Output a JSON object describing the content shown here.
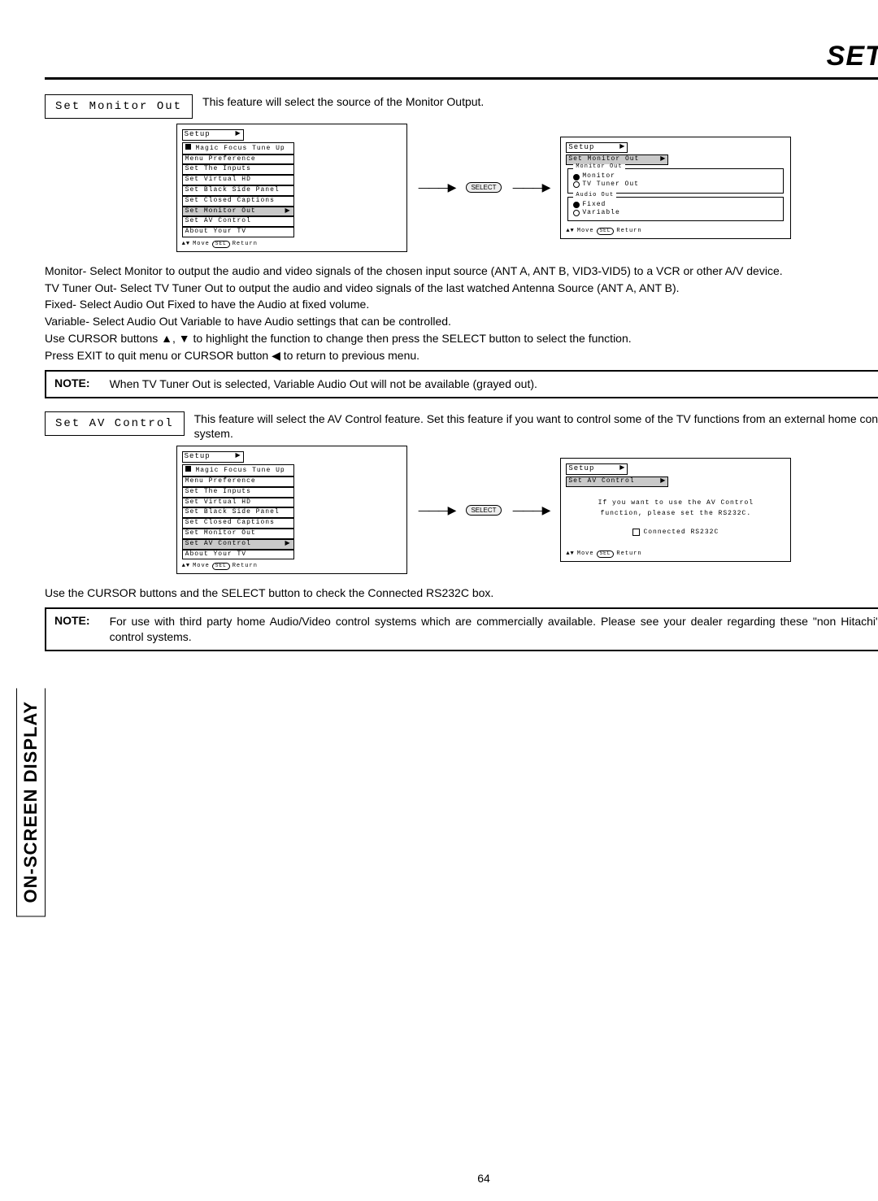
{
  "title": "Setup",
  "side_tab": "On-Screen Display",
  "page_number": "64",
  "sec1": {
    "label": "Set Monitor Out",
    "desc": "This feature will select the source of the Monitor Output.",
    "menu_title": "Setup",
    "items": [
      "Magic Focus Tune Up",
      "Menu Preference",
      "Set The Inputs",
      "Set Virtual HD",
      "Set Black Side Panel",
      "Set Closed Captions",
      "Set Monitor Out",
      "Set AV Control",
      "About Your TV"
    ],
    "highlight": "Set Monitor Out",
    "foot_move": "Move",
    "foot_sel": "SEL",
    "foot_return": "Return",
    "select_label": "SELECT",
    "sub_title": "Set Monitor Out",
    "group1": "Monitor Out",
    "opt1a": "Monitor",
    "opt1b": "TV Tuner Out",
    "group2": "Audio Out",
    "opt2a": "Fixed",
    "opt2b": "Variable",
    "p_monitor": "Monitor- Select Monitor to output the audio and video signals of the chosen input source (ANT A, ANT B, VID3-VID5) to a VCR or other A/V device.",
    "p_tvtuner": "TV Tuner Out- Select TV Tuner Out to output the audio and video signals of the last watched Antenna Source (ANT A, ANT B).",
    "p_fixed": "Fixed-  Select Audio Out Fixed to have the Audio at fixed volume.",
    "p_variable": "Variable- Select Audio Out Variable to have Audio settings that can be controlled.",
    "p_cursor": "Use CURSOR buttons ▲, ▼ to highlight the function to change then press the SELECT button to select the function.",
    "p_exit": "Press EXIT to quit menu or CURSOR button ◀ to return to previous menu.",
    "note_label": "NOTE:",
    "note_text": "When TV Tuner Out is selected, Variable Audio Out will not be available (grayed out)."
  },
  "sec2": {
    "label": "Set AV Control",
    "desc": "This feature will select the AV Control feature.  Set this feature if you want to control some of the TV functions from an external home control system.",
    "menu_title": "Setup",
    "highlight": "Set AV Control",
    "sub_title": "Set AV Control",
    "msg1": "If you want to use the AV Control",
    "msg2": "function, please set the RS232C.",
    "chk_label": "Connected RS232C",
    "p_after": "Use the CURSOR buttons and the SELECT button to check the Connected RS232C box.",
    "note_label": "NOTE:",
    "note_text": "For use with third party home Audio/Video control systems which are commercially available.  Please see your dealer regarding these \"non Hitachi\" home control systems."
  }
}
